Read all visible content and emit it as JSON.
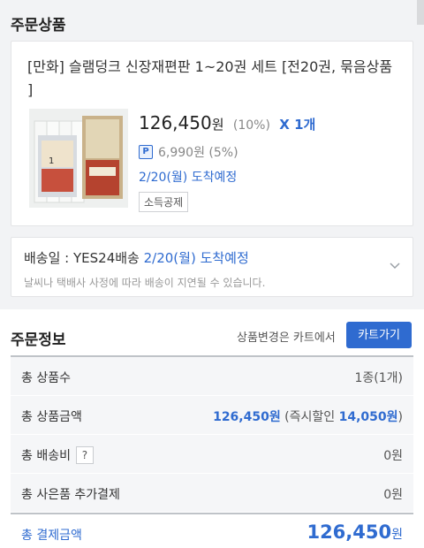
{
  "section_title": "주문상품",
  "product": {
    "title": "[만화] 슬램덩크 신장재편판 1~20권 세트 [전20권, 묶음상품 ]",
    "price": "126,450",
    "price_unit": "원",
    "discount": "(10%)",
    "quantity": "X 1개",
    "point_badge": "P",
    "points": "6,990원 (5%)",
    "arrival": "2/20(월) 도착예정",
    "tag": "소득공제"
  },
  "shipping": {
    "label": "배송일 : YES24배송 ",
    "date": "2/20(월) 도착예정",
    "notice": "날씨나 택배사 사정에 따라 배송이 지연될 수 있습니다."
  },
  "order_info": {
    "title": "주문정보",
    "change_text": "상품변경은 카트에서",
    "cart_button": "카트가기",
    "rows": [
      {
        "label": "총 상품수",
        "value": "1종(1개)"
      },
      {
        "label": "총 상품금액",
        "value_main": "126,450원",
        "value_paren_open": " (즉시할인 ",
        "value_discount": "14,050원",
        "value_paren_close": ")"
      },
      {
        "label": "총 배송비",
        "help": "?",
        "value": "0원"
      },
      {
        "label": "총 사은품 추가결제",
        "value": "0원"
      }
    ],
    "total": {
      "label": "총 결제금액",
      "value": "126,450",
      "unit": "원"
    }
  },
  "colors": {
    "accent": "#2f6bd0",
    "background": "#f2f3f5"
  }
}
